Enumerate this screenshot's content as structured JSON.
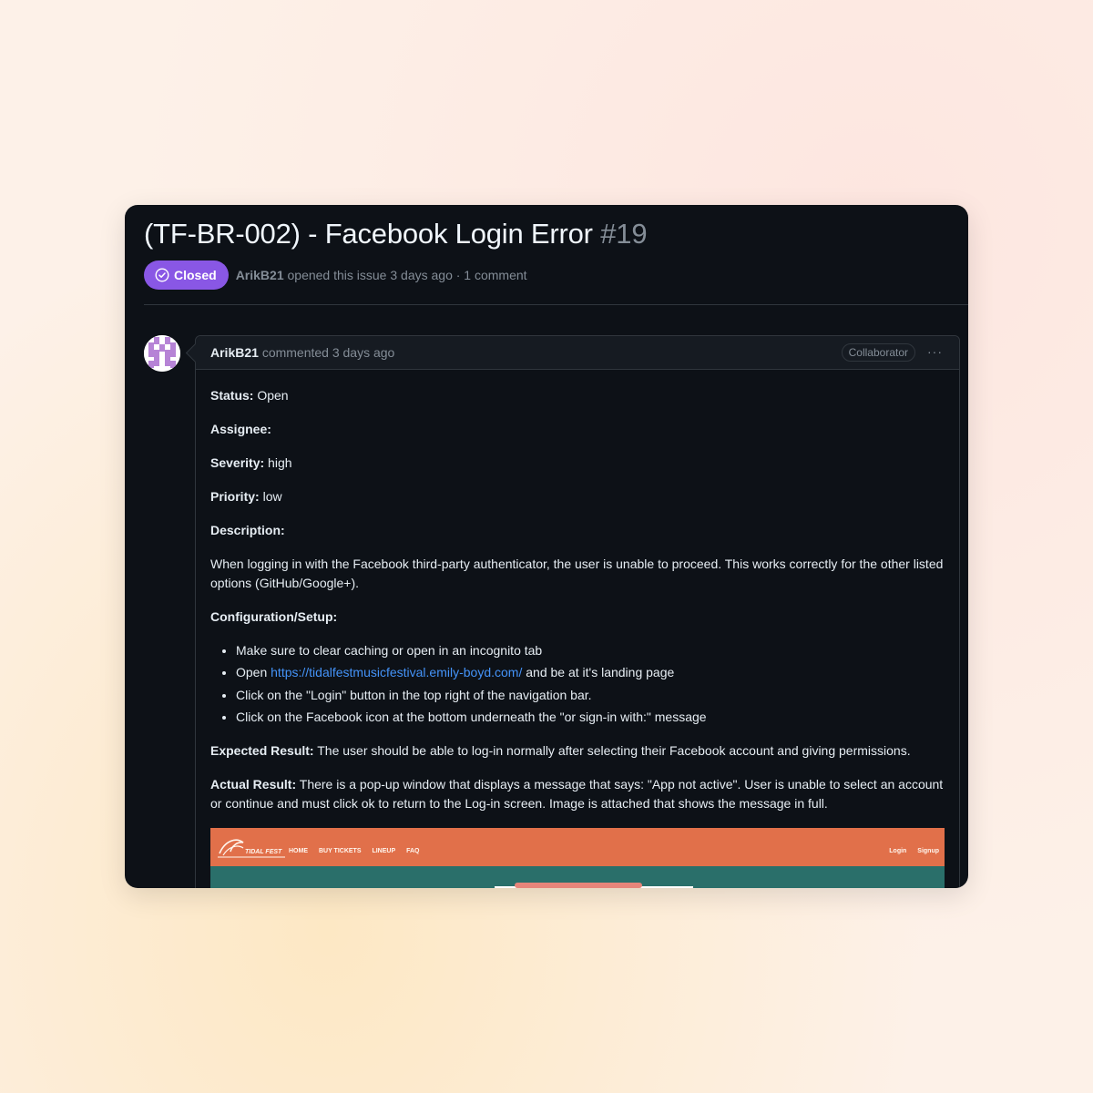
{
  "issue": {
    "title": "(TF-BR-002) - Facebook Login Error",
    "number": "#19",
    "state": "Closed",
    "author": "ArikB21",
    "meta": "opened this issue 3 days ago · 1 comment"
  },
  "comment": {
    "author": "ArikB21",
    "action": "commented 3 days ago",
    "role_badge": "Collaborator",
    "menu": "···",
    "fields": {
      "status_label": "Status:",
      "status_value": "Open",
      "assignee_label": "Assignee:",
      "severity_label": "Severity:",
      "severity_value": "high",
      "priority_label": "Priority:",
      "priority_value": "low",
      "description_label": "Description:",
      "description_text": "When logging in with the Facebook third-party authenticator, the user is unable to proceed. This works correctly for the other listed options (GitHub/Google+).",
      "config_label": "Configuration/Setup:",
      "steps": {
        "step1": "Make sure to clear caching or open in an incognito tab",
        "step2_pre": "Open",
        "step2_link": "https://tidalfestmusicfestival.emily-boyd.com/",
        "step2_post": "and be at it's landing page",
        "step3": "Click on the \"Login\" button in the top right of the navigation bar.",
        "step4": "Click on the Facebook icon at the bottom underneath the \"or sign-in with:\" message"
      },
      "expected_label": "Expected Result:",
      "expected_text": "The user should be able to log-in normally after selecting their Facebook account and giving permissions.",
      "actual_label": "Actual Result:",
      "actual_text": "There is a pop-up window that displays a message that says: \"App not active\". User is unable to select an account or continue and must click ok to return to the Log-in screen. Image is attached that shows the message in full."
    },
    "screenshot": {
      "logo_text": "TIDAL FEST",
      "nav": [
        "HOME",
        "BUY TICKETS",
        "LINEUP",
        "FAQ"
      ],
      "nav_right": [
        "Login",
        "Signup"
      ]
    }
  },
  "colors": {
    "closed_badge": "#8957e5",
    "link": "#4493f8",
    "background": "#0d1117",
    "screenshot_nav": "#e1704a",
    "screenshot_body": "#2a6f6a"
  }
}
